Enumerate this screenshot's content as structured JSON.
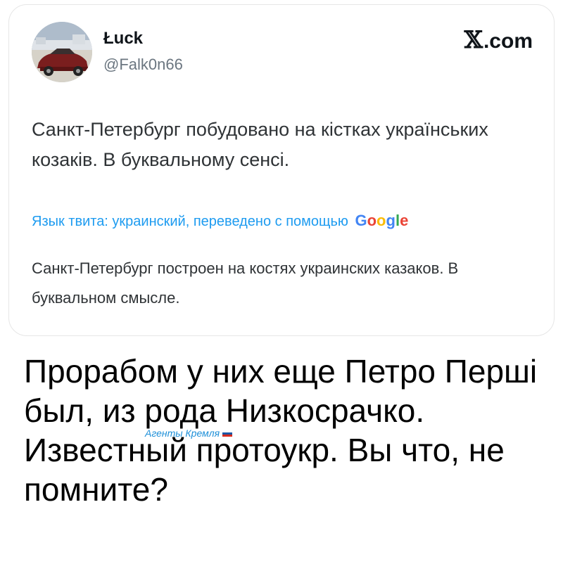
{
  "tweet": {
    "display_name": "Łuck",
    "handle": "@Falk0n66",
    "brand": {
      "mark": "𝕏",
      "suffix": ".com"
    },
    "text": "Санкт-Петербург побудовано на кістках українських козаків. В буквальному сенсі.",
    "translation_label": "Язык твита: украинский, переведено с помощью",
    "translation_provider": "Google",
    "google_colors": [
      "#4285F4",
      "#EA4335",
      "#FBBC05",
      "#4285F4",
      "#34A853",
      "#EA4335"
    ],
    "translated_text": "Санкт-Петербург построен на костях украинских казаков. В буквальном смысле."
  },
  "caption": {
    "text": "Прорабом у них еще Петро Перші был, из рода Низкосрачко. Известный протоукр. Вы что, не помните?"
  },
  "watermark": {
    "text": "Агенты Кремля",
    "flag_colors": [
      "#ffffff",
      "#1c57a5",
      "#d52b1e"
    ]
  }
}
